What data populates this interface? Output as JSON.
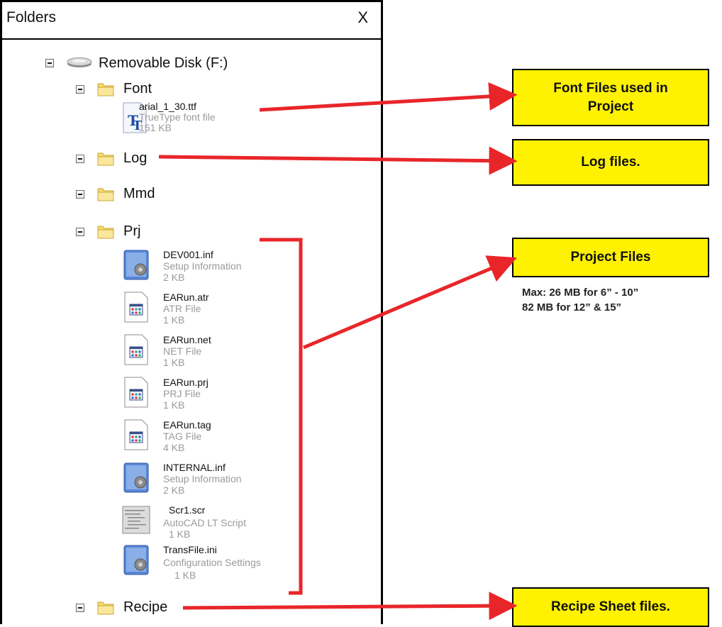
{
  "pane": {
    "title": "Folders",
    "close_label": "X"
  },
  "tree": {
    "root": {
      "label": "Removable Disk (F:)",
      "icon": "drive-icon"
    },
    "folders": {
      "font": {
        "label": "Font",
        "icon": "folder-icon"
      },
      "log": {
        "label": "Log",
        "icon": "folder-icon"
      },
      "mmd": {
        "label": "Mmd",
        "icon": "folder-icon"
      },
      "prj": {
        "label": "Prj",
        "icon": "folder-icon"
      },
      "recipe": {
        "label": "Recipe",
        "icon": "folder-icon"
      }
    },
    "font_files": [
      {
        "name": "arial_1_30.ttf",
        "type": "TrueType font file",
        "size": "151 KB",
        "icon": "truetype-font-icon"
      }
    ],
    "prj_files": [
      {
        "name": "DEV001.inf",
        "type": "Setup Information",
        "size": "2 KB",
        "icon": "setup-info-icon"
      },
      {
        "name": "EARun.atr",
        "type": "ATR File",
        "size": "1 KB",
        "icon": "app-file-icon"
      },
      {
        "name": "EARun.net",
        "type": "NET File",
        "size": "1 KB",
        "icon": "app-file-icon"
      },
      {
        "name": "EARun.prj",
        "type": "PRJ File",
        "size": "1 KB",
        "icon": "app-file-icon"
      },
      {
        "name": "EARun.tag",
        "type": "TAG File",
        "size": "4 KB",
        "icon": "app-file-icon"
      },
      {
        "name": "INTERNAL.inf",
        "type": "Setup Information",
        "size": "2 KB",
        "icon": "setup-info-icon"
      },
      {
        "name": "Scr1.scr",
        "type": "AutoCAD LT Script",
        "size": "1 KB",
        "icon": "script-file-icon"
      },
      {
        "name": "TransFile.ini",
        "type": "Configuration Settings",
        "size": "1 KB",
        "icon": "config-settings-icon"
      }
    ]
  },
  "callouts": {
    "font": "Font Files used in Project",
    "log": "Log files.",
    "project": "Project Files",
    "recipe": "Recipe Sheet files."
  },
  "notes": {
    "project_line1": "Max: 26 MB for 6” - 10”",
    "project_line2": "82 MB for 12” & 15”"
  },
  "colors": {
    "callout_fill": "#fff200",
    "arrow": "#e8262a",
    "folder": "#f7d86b"
  }
}
